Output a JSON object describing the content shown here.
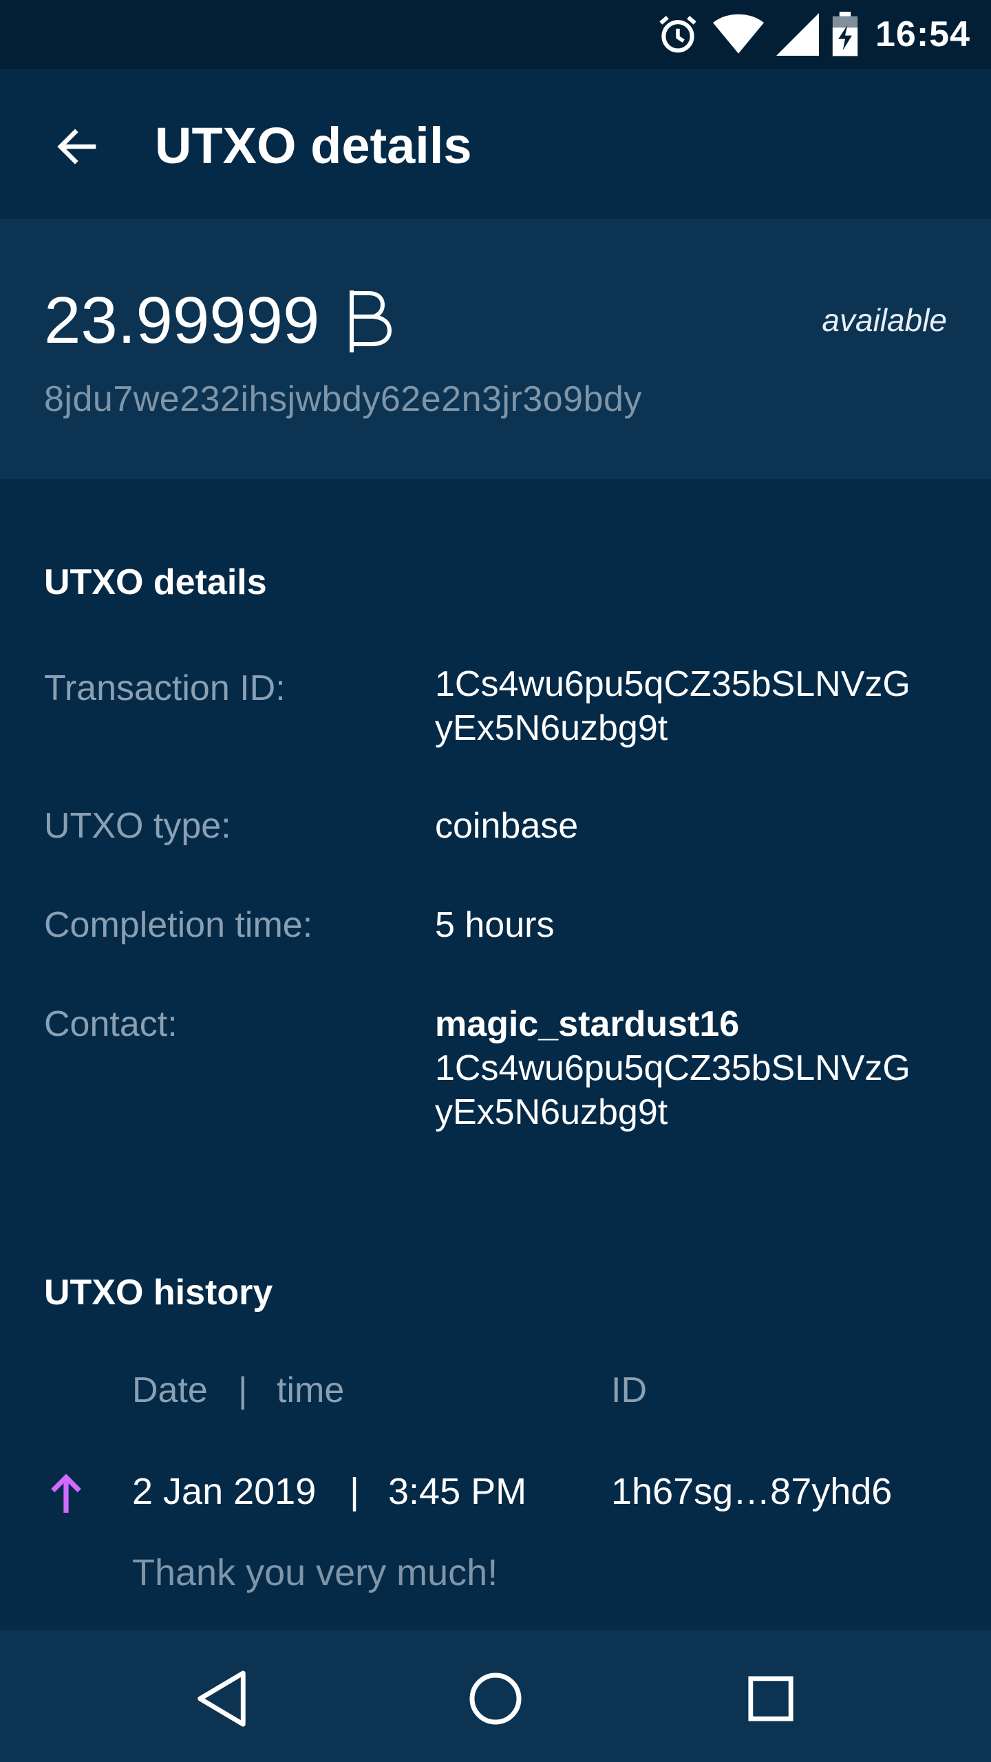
{
  "status_bar": {
    "time": "16:54",
    "icons": [
      "alarm-icon",
      "wifi-icon",
      "cell-signal-icon",
      "battery-charging-icon"
    ]
  },
  "app_bar": {
    "title": "UTXO details",
    "back_icon": "arrow-back-icon"
  },
  "balance": {
    "amount": "23.99999",
    "currency_icon": "beam-coin-icon",
    "status": "available",
    "address": "8jdu7we232ihsjwbdy62e2n3jr3o9bdy"
  },
  "details": {
    "title": "UTXO details",
    "transaction_id_label": "Transaction ID:",
    "transaction_id_line1": "1Cs4wu6pu5qCZ35bSLNVzG",
    "transaction_id_line2": "yEx5N6uzbg9t",
    "type_label": "UTXO type:",
    "type_value": "coinbase",
    "completion_label": "Completion time:",
    "completion_value": "5 hours",
    "contact_label": "Contact:",
    "contact_name": "magic_stardust16",
    "contact_address_line1": "1Cs4wu6pu5qCZ35bSLNVzG",
    "contact_address_line2": "yEx5N6uzbg9t"
  },
  "history": {
    "title": "UTXO history",
    "header_date": "Date",
    "header_separator": "|",
    "header_time": "time",
    "header_id": "ID",
    "rows": [
      {
        "direction_icon": "arrow-up-icon",
        "date": "2 Jan 2019",
        "separator": "|",
        "time": "3:45 PM",
        "id": "1h67sg…87yhd6",
        "memo": "Thank you very much!"
      }
    ]
  },
  "nav_bar": {
    "back_icon": "nav-back-icon",
    "home_icon": "nav-home-icon",
    "recents_icon": "nav-recents-icon"
  },
  "colors": {
    "background": "#052a47",
    "card": "#0c3452",
    "label": "#8aa0b2",
    "accent": "#d16aff"
  }
}
